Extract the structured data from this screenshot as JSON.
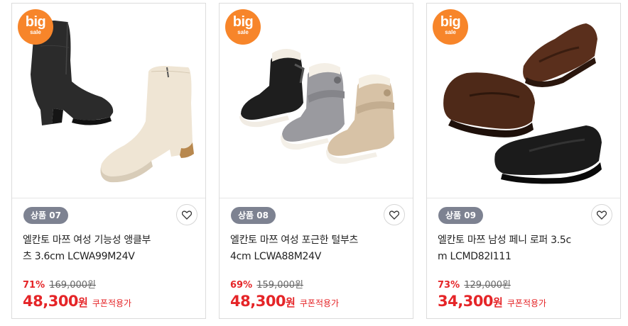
{
  "products": [
    {
      "badge": {
        "big": "big",
        "sale": "sale"
      },
      "tag": "상품 07",
      "title_line1": "엘칸토 마쯔 여성 기능성 앵클부",
      "title_line2": "츠 3.6cm LCWA99M24V",
      "discount": "71%",
      "original_price": "169,000원",
      "price": "48,300",
      "currency": "원",
      "coupon": "쿠폰적용가",
      "image_icon": "ankle-boots-image"
    },
    {
      "badge": {
        "big": "big",
        "sale": "sale"
      },
      "tag": "상품 08",
      "title_line1": "엘칸토 마쯔 여성 포근한 털부츠",
      "title_line2": "4cm LCWA88M24V",
      "discount": "69%",
      "original_price": "159,000원",
      "price": "48,300",
      "currency": "원",
      "coupon": "쿠폰적용가",
      "image_icon": "fur-boots-image"
    },
    {
      "badge": {
        "big": "big",
        "sale": "sale"
      },
      "tag": "상품 09",
      "title_line1": "엘칸토 마쯔 남성 페니 로퍼 3.5c",
      "title_line2": "m LCMD82I111",
      "discount": "73%",
      "original_price": "129,000원",
      "price": "34,300",
      "currency": "원",
      "coupon": "쿠폰적용가",
      "image_icon": "penny-loafers-image"
    }
  ],
  "colors": {
    "accent_red": "#e52528",
    "badge_orange": "#f7852a",
    "tag_gray": "#7d8291",
    "border": "#dcdcdc"
  },
  "icons": {
    "wishlist": "heart-icon"
  }
}
